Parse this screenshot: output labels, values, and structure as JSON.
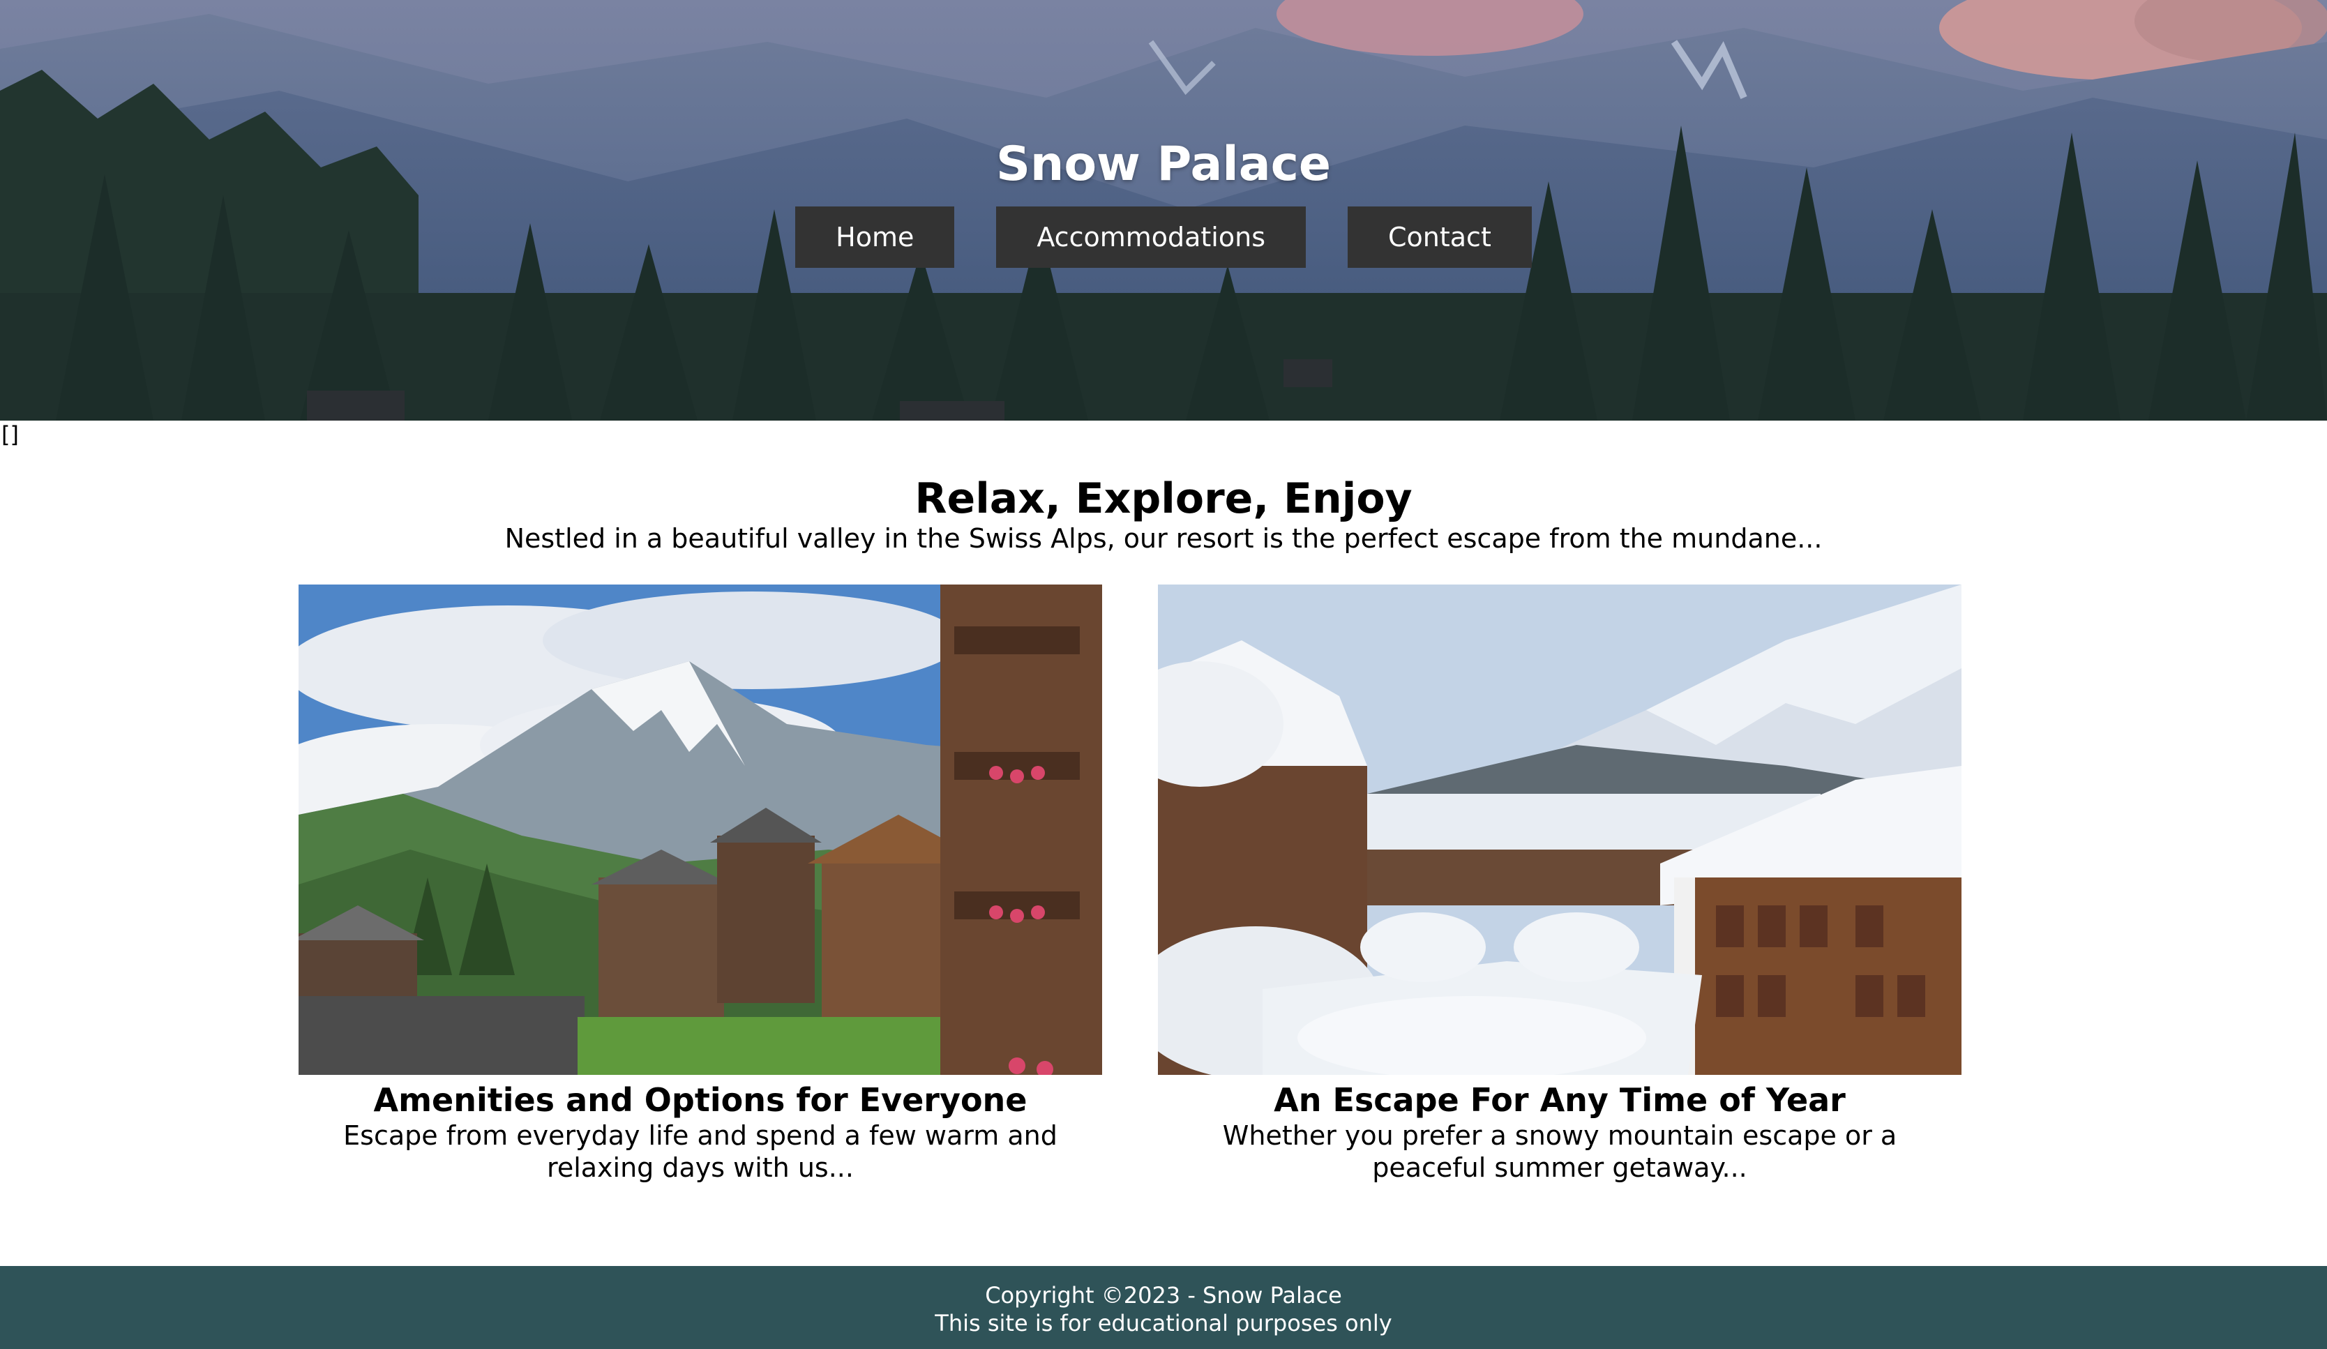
{
  "header": {
    "title": "Snow Palace",
    "nav": [
      {
        "label": "Home"
      },
      {
        "label": "Accommodations"
      },
      {
        "label": "Contact"
      }
    ]
  },
  "stray_text": "[]",
  "intro": {
    "heading": "Relax, Explore, Enjoy",
    "text": "Nestled in a beautiful valley in the Swiss Alps, our resort is the perfect escape from the mundane..."
  },
  "cards": [
    {
      "title": "Amenities and Options for Everyone",
      "text": "Escape from everyday life and spend a few warm and relaxing days with us..."
    },
    {
      "title": "An Escape For Any Time of Year",
      "text": "Whether you prefer a snowy mountain escape or a peaceful summer getaway..."
    }
  ],
  "footer": {
    "copyright": "Copyright ©2023 - Snow Palace",
    "note": "This site is for educational purposes only"
  },
  "colors": {
    "nav_button_bg": "#333333",
    "footer_bg": "#2f5358"
  }
}
